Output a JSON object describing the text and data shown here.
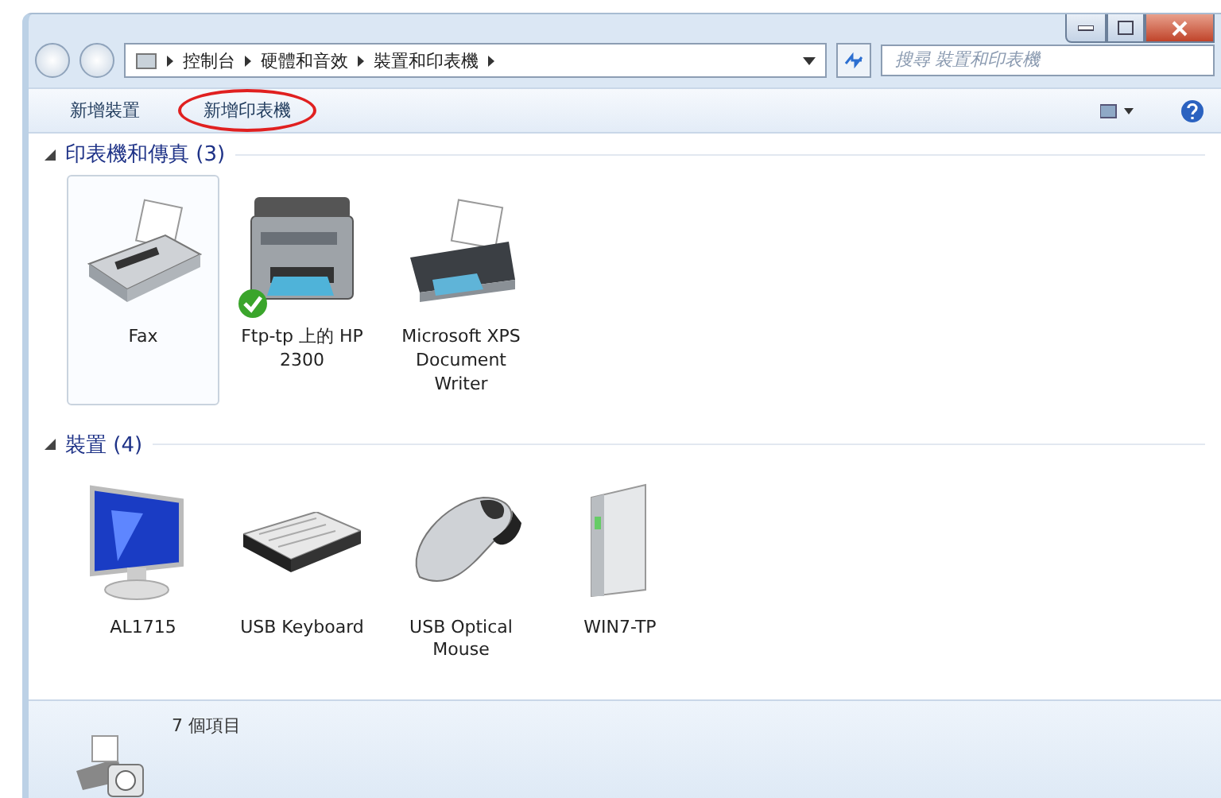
{
  "address": {
    "crumbs": [
      "控制台",
      "硬體和音效",
      "裝置和印表機"
    ]
  },
  "search": {
    "placeholder": "搜尋 裝置和印表機"
  },
  "toolbar": [
    {
      "label": "新增裝置",
      "highlighted": false
    },
    {
      "label": "新增印表機",
      "highlighted": true
    }
  ],
  "groups": [
    {
      "title": "印表機和傳真 (3)",
      "expanded": true,
      "items": [
        {
          "kind": "fax",
          "label": "Fax",
          "selected": true,
          "default": false
        },
        {
          "kind": "printer",
          "label": "Ftp-tp 上的 HP 2300",
          "selected": false,
          "default": true
        },
        {
          "kind": "xps",
          "label": "Microsoft XPS Document Writer",
          "selected": false,
          "default": false
        }
      ]
    },
    {
      "title": "裝置 (4)",
      "expanded": true,
      "items": [
        {
          "kind": "monitor",
          "label": "AL1715",
          "selected": false,
          "default": false
        },
        {
          "kind": "keyboard",
          "label": "USB Keyboard",
          "selected": false,
          "default": false
        },
        {
          "kind": "mouse",
          "label": "USB Optical Mouse",
          "selected": false,
          "default": false
        },
        {
          "kind": "computer",
          "label": "WIN7-TP",
          "selected": false,
          "default": false
        }
      ]
    }
  ],
  "status": {
    "count": "7 個項目"
  }
}
